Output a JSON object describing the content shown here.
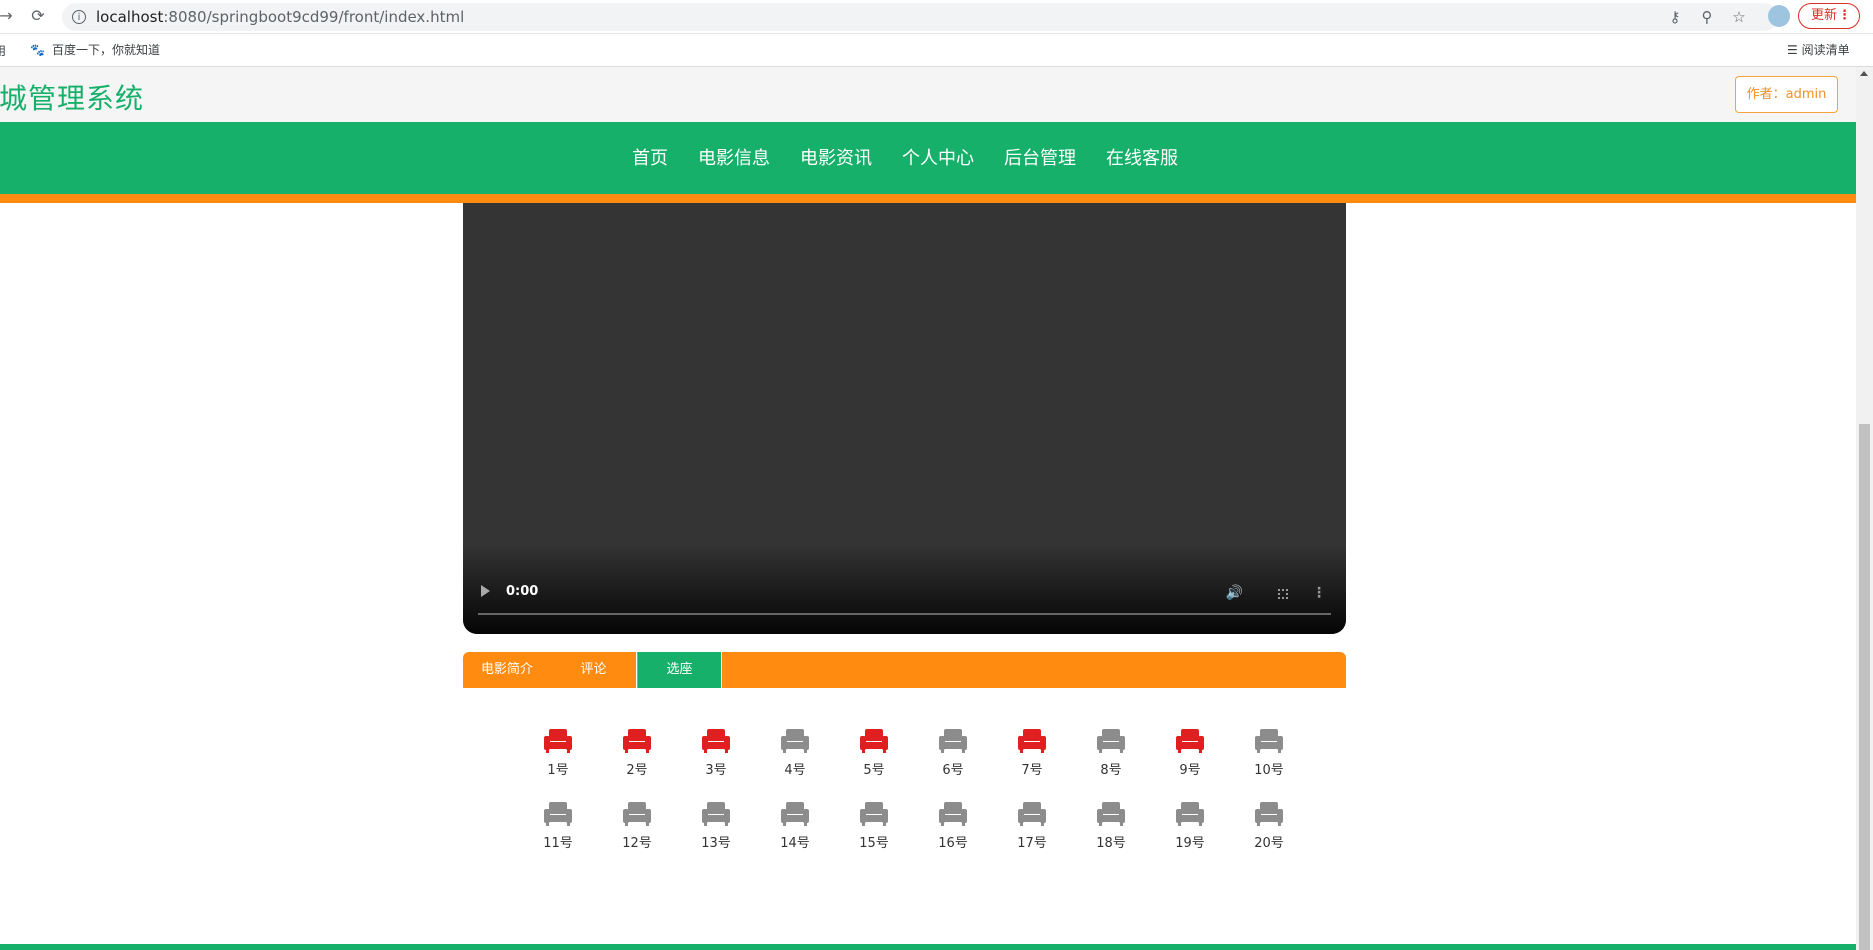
{
  "browser": {
    "url_host": "localhost",
    "url_rest": ":8080/springboot9cd99/front/index.html",
    "update_label": "更新",
    "bookmarks": {
      "apps_label": "应用",
      "baidu_label": "百度一下，你就知道",
      "reading_list_label": "阅读清单"
    }
  },
  "header": {
    "site_title": "影城管理系统",
    "author_label": "作者：admin"
  },
  "nav": {
    "items": [
      "首页",
      "电影信息",
      "电影资讯",
      "个人中心",
      "后台管理",
      "在线客服"
    ]
  },
  "video": {
    "time": "0:00"
  },
  "tabs": {
    "items": [
      "电影简介",
      "评论",
      "选座"
    ],
    "active": "选座"
  },
  "colors": {
    "brand_green": "#16b06a",
    "accent_orange": "#ff8c11",
    "seat_taken": "#e02020",
    "seat_free": "#8c8c8c"
  },
  "seats": [
    {
      "label": "1号",
      "status": "taken"
    },
    {
      "label": "2号",
      "status": "taken"
    },
    {
      "label": "3号",
      "status": "taken"
    },
    {
      "label": "4号",
      "status": "free"
    },
    {
      "label": "5号",
      "status": "taken"
    },
    {
      "label": "6号",
      "status": "free"
    },
    {
      "label": "7号",
      "status": "taken"
    },
    {
      "label": "8号",
      "status": "free"
    },
    {
      "label": "9号",
      "status": "taken"
    },
    {
      "label": "10号",
      "status": "free"
    },
    {
      "label": "11号",
      "status": "free"
    },
    {
      "label": "12号",
      "status": "free"
    },
    {
      "label": "13号",
      "status": "free"
    },
    {
      "label": "14号",
      "status": "free"
    },
    {
      "label": "15号",
      "status": "free"
    },
    {
      "label": "16号",
      "status": "free"
    },
    {
      "label": "17号",
      "status": "free"
    },
    {
      "label": "18号",
      "status": "free"
    },
    {
      "label": "19号",
      "status": "free"
    },
    {
      "label": "20号",
      "status": "free"
    }
  ]
}
